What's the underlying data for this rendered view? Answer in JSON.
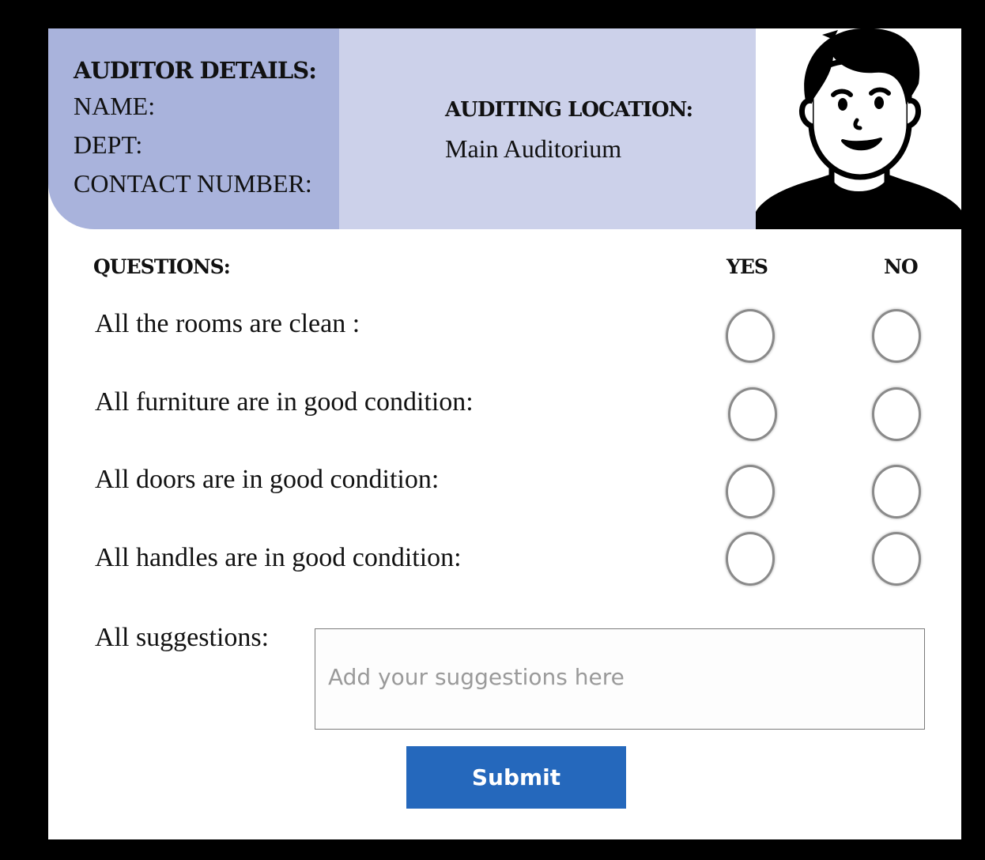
{
  "header": {
    "auditor_title": "AUDITOR DETAILS:",
    "name_label": "NAME:",
    "dept_label": "DEPT:",
    "contact_label": "CONTACT NUMBER:",
    "location_title": "AUDITING LOCATION:",
    "location_value": "Main Auditorium",
    "avatar_icon": "person-avatar-icon"
  },
  "questions": {
    "heading": "QUESTIONS:",
    "yes_label": "YES",
    "no_label": "NO",
    "items": [
      {
        "text": "All the rooms are clean  :",
        "answer": null
      },
      {
        "text": "All furniture are in good condition:",
        "answer": null
      },
      {
        "text": "All doors are in good condition:",
        "answer": null
      },
      {
        "text": "All handles are in good condition:",
        "answer": null
      }
    ]
  },
  "suggestions": {
    "label": "All suggestions:",
    "placeholder": "Add your suggestions here",
    "value": ""
  },
  "submit": {
    "label": "Submit"
  },
  "colors": {
    "auditor_panel": "#a9b3dc",
    "location_panel": "#ccd1ea",
    "submit_button": "#2568bc",
    "frame": "#000000"
  }
}
